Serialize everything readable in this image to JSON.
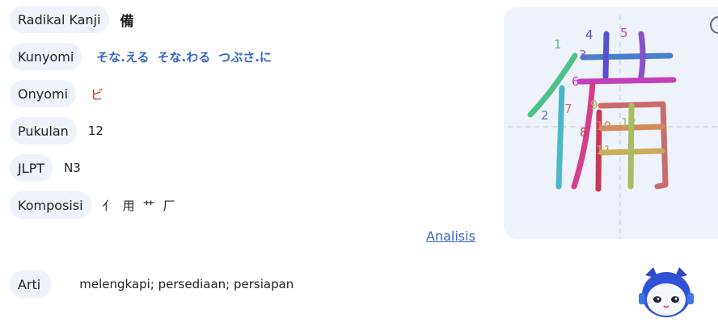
{
  "rows": {
    "radikal": {
      "label": "Radikal Kanji",
      "value": "備"
    },
    "kunyomi": {
      "label": "Kunyomi",
      "values": [
        "そな.える",
        "そな.わる",
        "つぶさ.に"
      ]
    },
    "onyomi": {
      "label": "Onyomi",
      "value": "ビ"
    },
    "pukulan": {
      "label": "Pukulan",
      "value": "12"
    },
    "jlpt": {
      "label": "JLPT",
      "value": "N3"
    },
    "komposisi": {
      "label": "Komposisi",
      "parts": [
        "亻",
        "用",
        "艹",
        "厂"
      ]
    }
  },
  "analysis_link": "Analisis",
  "arti": {
    "label": "Arti",
    "value": "melengkapi; persediaan; persiapan"
  },
  "stroke_numbers": [
    "1",
    "2",
    "3",
    "4",
    "5",
    "6",
    "7",
    "8",
    "9",
    "10",
    "11",
    "12"
  ],
  "colors": {
    "link": "#3a66c4",
    "onyomi": "#d3302f",
    "pill_bg": "#eef2fa",
    "panel_bg": "#eef3fb"
  }
}
